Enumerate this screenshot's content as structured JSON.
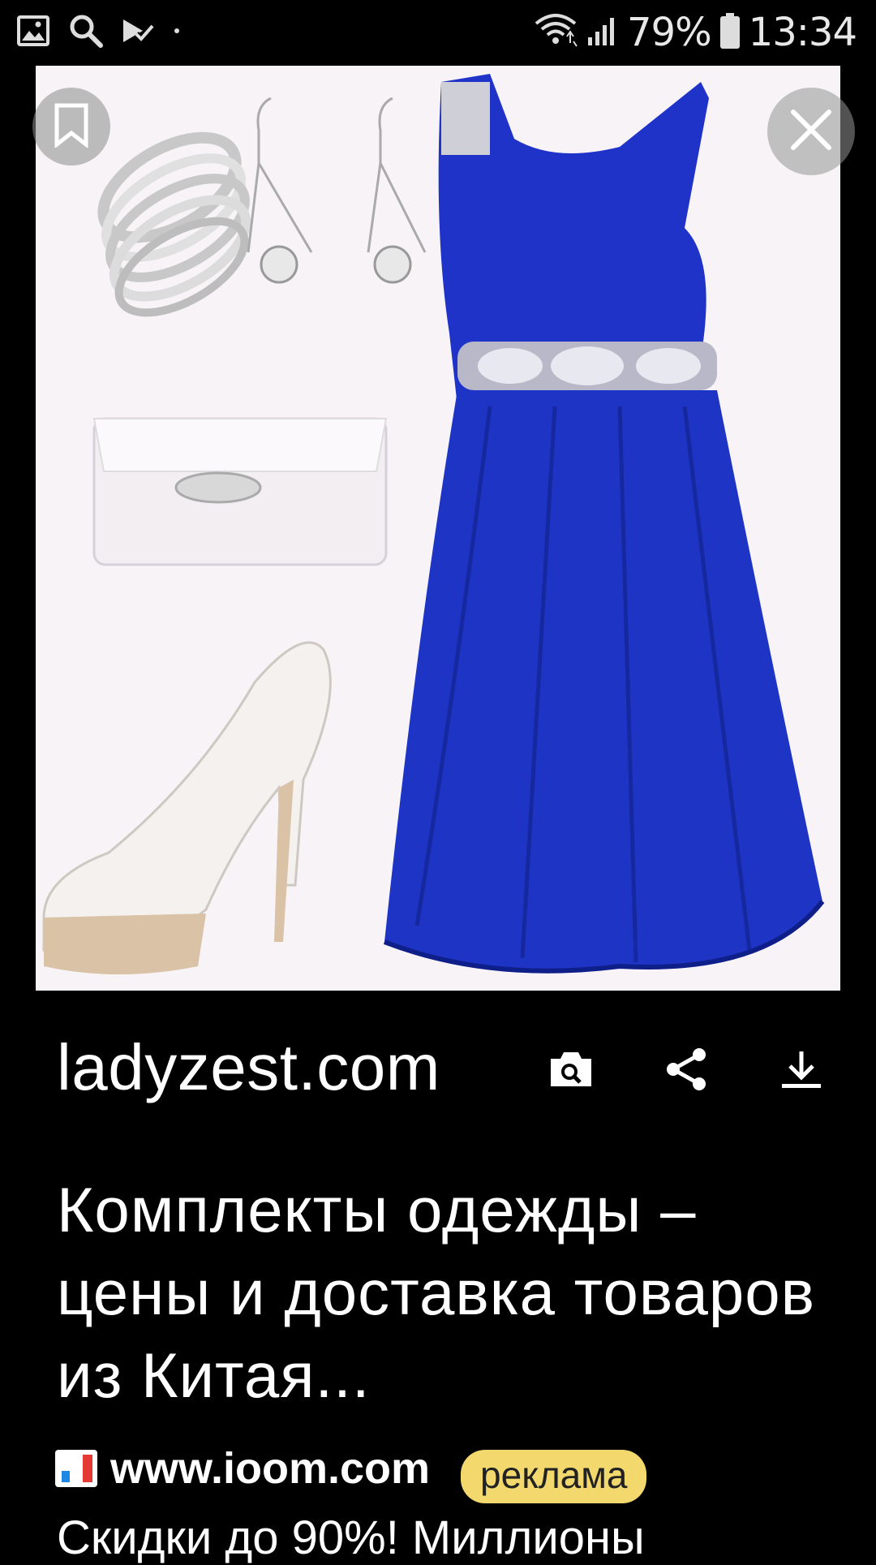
{
  "status_bar": {
    "battery_percent": "79%",
    "time": "13:34",
    "icons": [
      "gallery-icon",
      "search-icon",
      "task-check-icon",
      "wifi-icon",
      "signal-icon",
      "battery-icon"
    ]
  },
  "image_viewer": {
    "image_description_icons": [
      "bookmark-icon",
      "close-icon"
    ],
    "source_domain": "ladyzest.com",
    "actions": [
      "visual-search-icon",
      "share-icon",
      "download-icon"
    ]
  },
  "result": {
    "title": "Комплекты одежды – цены и доставка товаров из Китая..."
  },
  "ad": {
    "url": "www.ioom.com",
    "badge": "реклама",
    "description": "Скидки до 90%! Миллионы"
  },
  "colors": {
    "dress_blue": "#1f33c8",
    "badge_yellow": "#f3d86d",
    "image_bg": "#f7f3f7"
  }
}
